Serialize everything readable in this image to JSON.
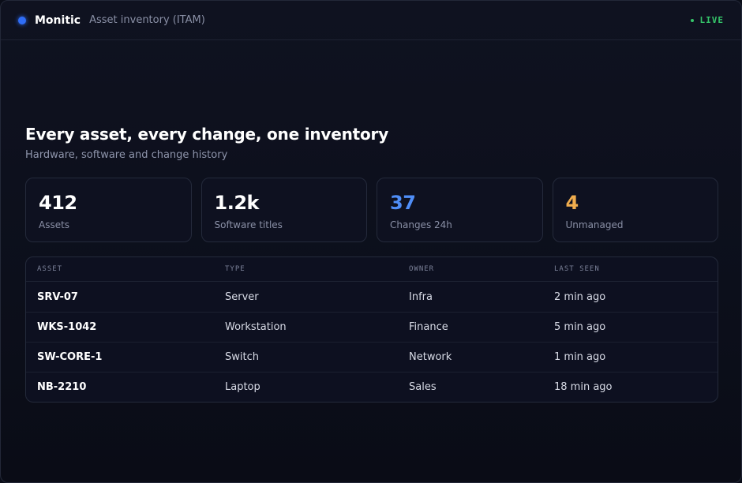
{
  "header": {
    "brand": "Monitic",
    "subtitle": "Asset inventory (ITAM)",
    "status": "LIVE"
  },
  "hero": {
    "title": "Every asset, every change, one inventory",
    "subtitle": "Hardware, software and change history"
  },
  "stats": [
    {
      "value": "412",
      "label": "Assets",
      "color": "#ffffff"
    },
    {
      "value": "1.2k",
      "label": "Software titles",
      "color": "#ffffff"
    },
    {
      "value": "37",
      "label": "Changes 24h",
      "color": "#4f8ef7"
    },
    {
      "value": "4",
      "label": "Unmanaged",
      "color": "#f0ad4e"
    }
  ],
  "table": {
    "columns": [
      "ASSET",
      "TYPE",
      "OWNER",
      "LAST SEEN"
    ],
    "rows": [
      {
        "asset": "SRV-07",
        "type": "Server",
        "owner": "Infra",
        "last_seen": "2 min ago"
      },
      {
        "asset": "WKS-1042",
        "type": "Workstation",
        "owner": "Finance",
        "last_seen": "5 min ago"
      },
      {
        "asset": "SW-CORE-1",
        "type": "Switch",
        "owner": "Network",
        "last_seen": "1 min ago"
      },
      {
        "asset": "NB-2210",
        "type": "Laptop",
        "owner": "Sales",
        "last_seen": "18 min ago"
      }
    ]
  },
  "colors": {
    "accent": "#2f6df6",
    "live": "#35c56a",
    "changes": "#4f8ef7",
    "unmanaged": "#f0ad4e"
  }
}
